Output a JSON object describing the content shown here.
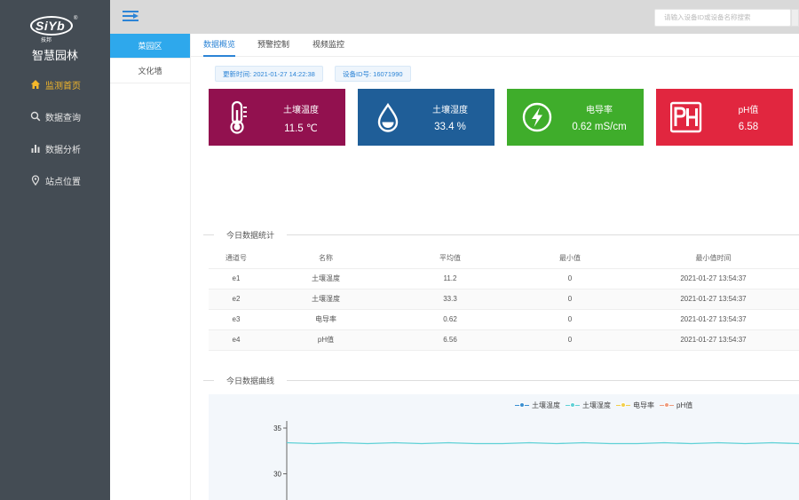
{
  "sidebar": {
    "logo_text": "SiYb",
    "logo_sub": "技邦",
    "logo_reg": "®",
    "title": "智慧园林",
    "items": [
      {
        "label": "监测首页",
        "icon": "home-icon",
        "active": true
      },
      {
        "label": "数据查询",
        "icon": "search-icon",
        "active": false
      },
      {
        "label": "数据分析",
        "icon": "bar-chart-icon",
        "active": false
      },
      {
        "label": "站点位置",
        "icon": "location-pin-icon",
        "active": false
      }
    ]
  },
  "topbar": {
    "menu_icon": "menu-toggle-icon",
    "search_placeholder": "请输入设备ID或设备名称搜索"
  },
  "areas": [
    {
      "label": "菜园区",
      "active": true
    },
    {
      "label": "文化墙",
      "active": false
    }
  ],
  "tabs": [
    {
      "label": "数据概览",
      "active": true
    },
    {
      "label": "预警控制",
      "active": false
    },
    {
      "label": "视频监控",
      "active": false
    }
  ],
  "info": {
    "update_time": "更新时间: 2021-01-27 14:22:38",
    "device_id": "设备ID号: 16071990"
  },
  "cards": [
    {
      "label": "土壤温度",
      "value": "11.5 ℃",
      "color": "#92114f",
      "icon": "thermometer-icon"
    },
    {
      "label": "土壤湿度",
      "value": "33.4 %",
      "color": "#1f5e98",
      "icon": "water-drop-icon"
    },
    {
      "label": "电导率",
      "value": "0.62 mS/cm",
      "color": "#3fad2b",
      "icon": "lightning-icon"
    },
    {
      "label": "pH值",
      "value": "6.58",
      "color": "#e1263f",
      "icon": "ph-icon"
    }
  ],
  "stats": {
    "title": "今日数据统计",
    "columns": [
      "通道号",
      "名称",
      "平均值",
      "最小值",
      "最小值时间"
    ],
    "rows": [
      [
        "e1",
        "土壤温度",
        "11.2",
        "0",
        "2021-01-27 13:54:37"
      ],
      [
        "e2",
        "土壤湿度",
        "33.3",
        "0",
        "2021-01-27 13:54:37"
      ],
      [
        "e3",
        "电导率",
        "0.62",
        "0",
        "2021-01-27 13:54:37"
      ],
      [
        "e4",
        "pH值",
        "6.56",
        "0",
        "2021-01-27 13:54:37"
      ]
    ]
  },
  "curve_title": "今日数据曲线",
  "colors": {
    "accent": "#2c84d6",
    "active_nav": "#f5b82a",
    "sidebar_bg": "#444c54"
  },
  "chart_data": {
    "type": "line",
    "title": "",
    "xlabel": "",
    "ylabel": "",
    "ylim": [
      20,
      35
    ],
    "y_ticks": [
      20,
      25,
      30,
      35
    ],
    "legend_position": "top-center",
    "series": [
      {
        "name": "土壤温度",
        "color": "#3a8fd1",
        "values": []
      },
      {
        "name": "土壤湿度",
        "color": "#5fd1d6",
        "values": [
          33.4,
          33.3,
          33.4,
          33.3,
          33.4,
          33.3,
          33.4,
          33.3,
          33.3,
          33.4,
          33.3,
          33.4,
          33.3,
          33.3,
          33.4,
          33.3,
          33.4,
          33.3,
          33.4,
          33.3
        ]
      },
      {
        "name": "电导率",
        "color": "#f2cf4a",
        "values": []
      },
      {
        "name": "pH值",
        "color": "#ef9b7d",
        "values": []
      }
    ]
  }
}
